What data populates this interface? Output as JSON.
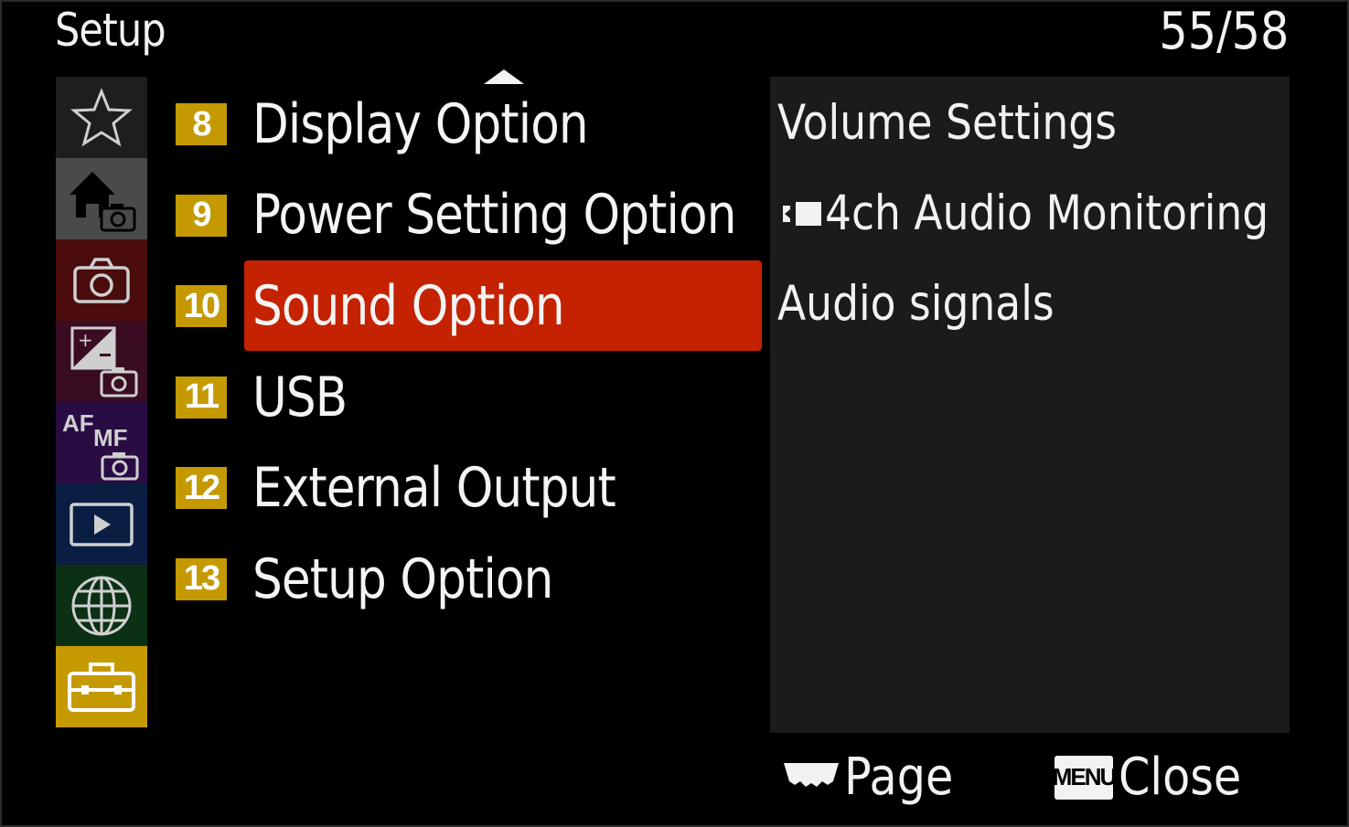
{
  "header": {
    "title": "Setup",
    "page_counter": "55/58"
  },
  "sidebar": {
    "items": [
      {
        "icon": "star-icon",
        "bg": "#1e1e1e"
      },
      {
        "icon": "home-camera-icon",
        "bg": "#4a4a4a"
      },
      {
        "icon": "camera-icon",
        "bg": "#4a0c0c"
      },
      {
        "icon": "exposure-camera-icon",
        "bg": "#3a0c22"
      },
      {
        "icon": "af-mf-camera-icon",
        "bg": "#2a0c44",
        "text_af": "AF",
        "text_mf": "MF"
      },
      {
        "icon": "play-icon",
        "bg": "#0a1e44"
      },
      {
        "icon": "globe-icon",
        "bg": "#0c3014"
      },
      {
        "icon": "toolbox-icon",
        "bg": "#c49a00",
        "active": true
      }
    ]
  },
  "menu": {
    "items": [
      {
        "number": "8",
        "label": "Display Option"
      },
      {
        "number": "9",
        "label": "Power Setting Option"
      },
      {
        "number": "10",
        "label": "Sound Option",
        "selected": true
      },
      {
        "number": "11",
        "label": "USB"
      },
      {
        "number": "12",
        "label": "External Output"
      },
      {
        "number": "13",
        "label": "Setup Option"
      }
    ]
  },
  "panel": {
    "items": [
      {
        "label": "Volume Settings"
      },
      {
        "label": "4ch Audio Monitoring",
        "icon": "movie-icon"
      },
      {
        "label": "Audio signals"
      }
    ]
  },
  "footer": {
    "page_label": "Page",
    "menu_key": "MENU",
    "close_label": "Close"
  },
  "colors": {
    "accent_selected": "#c42200",
    "badge": "#c49a00",
    "panel_bg": "#1b1b1b"
  }
}
